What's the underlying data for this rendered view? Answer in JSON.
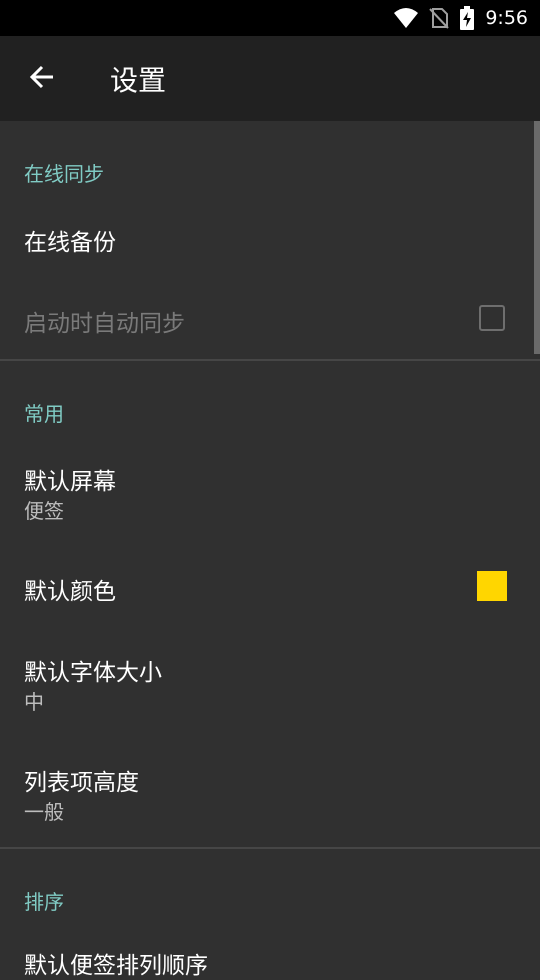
{
  "status_bar": {
    "time": "9:56"
  },
  "app_bar": {
    "title": "设置"
  },
  "sections": [
    {
      "header": "在线同步",
      "items": [
        {
          "title": "在线备份"
        },
        {
          "title": "启动时自动同步",
          "control": "checkbox",
          "checked": false,
          "enabled": false
        }
      ]
    },
    {
      "header": "常用",
      "items": [
        {
          "title": "默认屏幕",
          "subtitle": "便签"
        },
        {
          "title": "默认颜色",
          "control": "color",
          "color": "#FFD600"
        },
        {
          "title": "默认字体大小",
          "subtitle": "中"
        },
        {
          "title": "列表项高度",
          "subtitle": "一般"
        }
      ]
    },
    {
      "header": "排序",
      "items": [
        {
          "title": "默认便签排列顺序"
        }
      ]
    }
  ],
  "colors": {
    "accent": "#80cbc4",
    "background": "#303030",
    "app_bar": "#212121",
    "default_note_color": "#FFD600"
  }
}
